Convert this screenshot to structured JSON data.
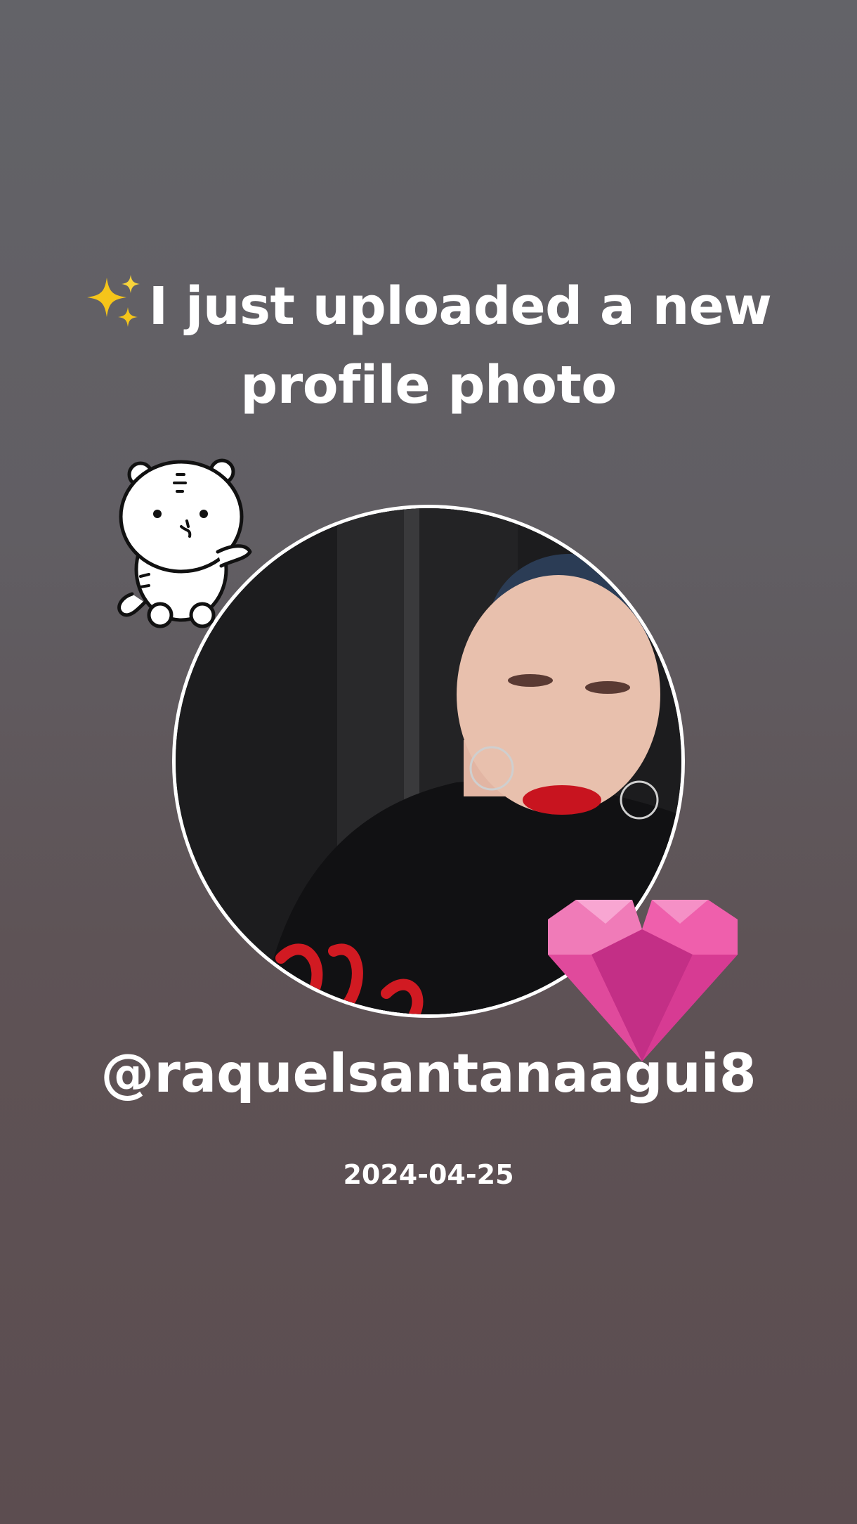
{
  "headline": {
    "icon": "sparkles-icon",
    "text": "I just uploaded a new profile photo"
  },
  "profile_photo": {
    "stickers": [
      "white-tiger-sticker",
      "pink-gem-heart-sticker"
    ]
  },
  "username": "@raquelsantanaagui8",
  "date": "2024-04-25",
  "colors": {
    "background_top": "#636368",
    "background_bottom": "#5c4d50",
    "text": "#ffffff",
    "photo_border": "#ffffff",
    "heart": "#e8419b",
    "sparkle": "#f5c51a"
  }
}
